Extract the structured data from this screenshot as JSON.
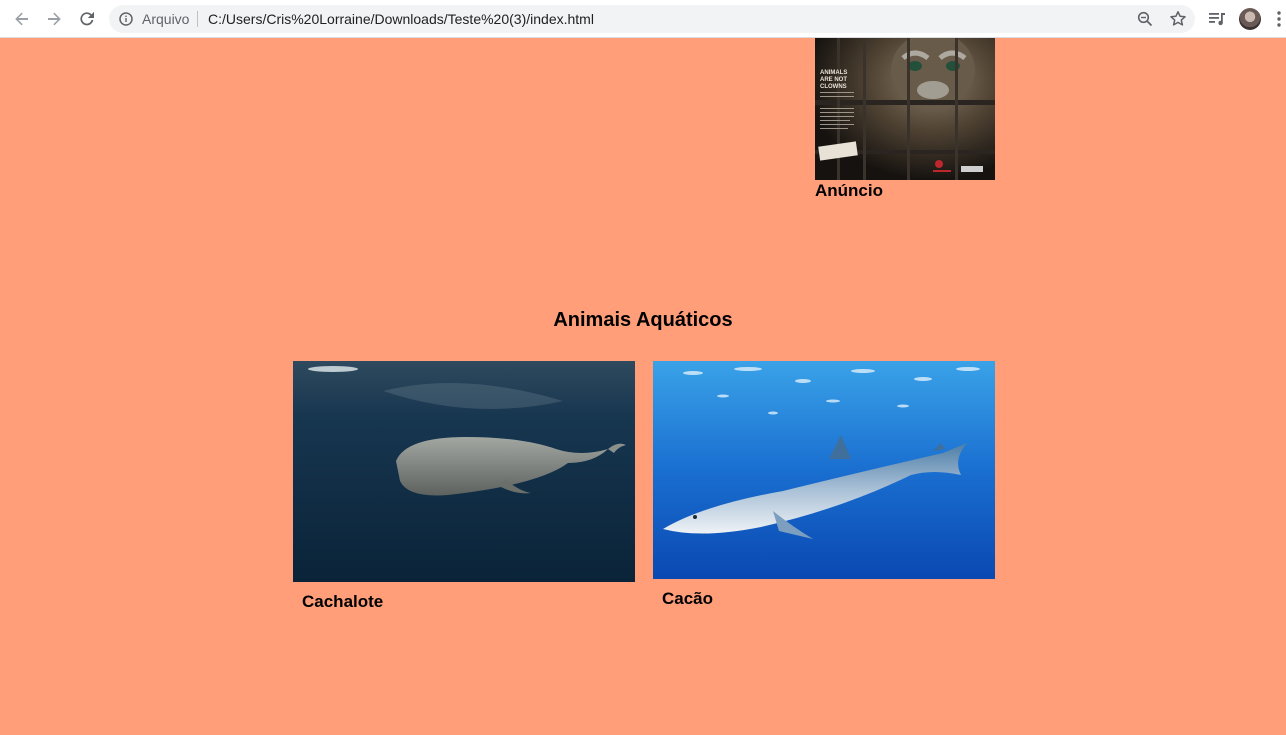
{
  "browser": {
    "scheme_label": "Arquivo",
    "url": "C:/Users/Cris%20Lorraine/Downloads/Teste%20(3)/index.html",
    "icons": [
      "back-icon",
      "forward-icon",
      "reload-icon",
      "info-icon",
      "zoom-icon",
      "star-icon",
      "media-icon",
      "avatar",
      "menu-icon"
    ]
  },
  "page": {
    "background": "#ff9e79",
    "ad": {
      "caption": "Anúncio",
      "poster_text": "ANIMALS ARE NOT CLOWNS"
    },
    "section_title": "Animais Aquáticos",
    "cards": [
      {
        "caption": "Cachalote",
        "image": "sperm whale underwater"
      },
      {
        "caption": "Cacão",
        "image": "blue shark underwater"
      }
    ]
  }
}
